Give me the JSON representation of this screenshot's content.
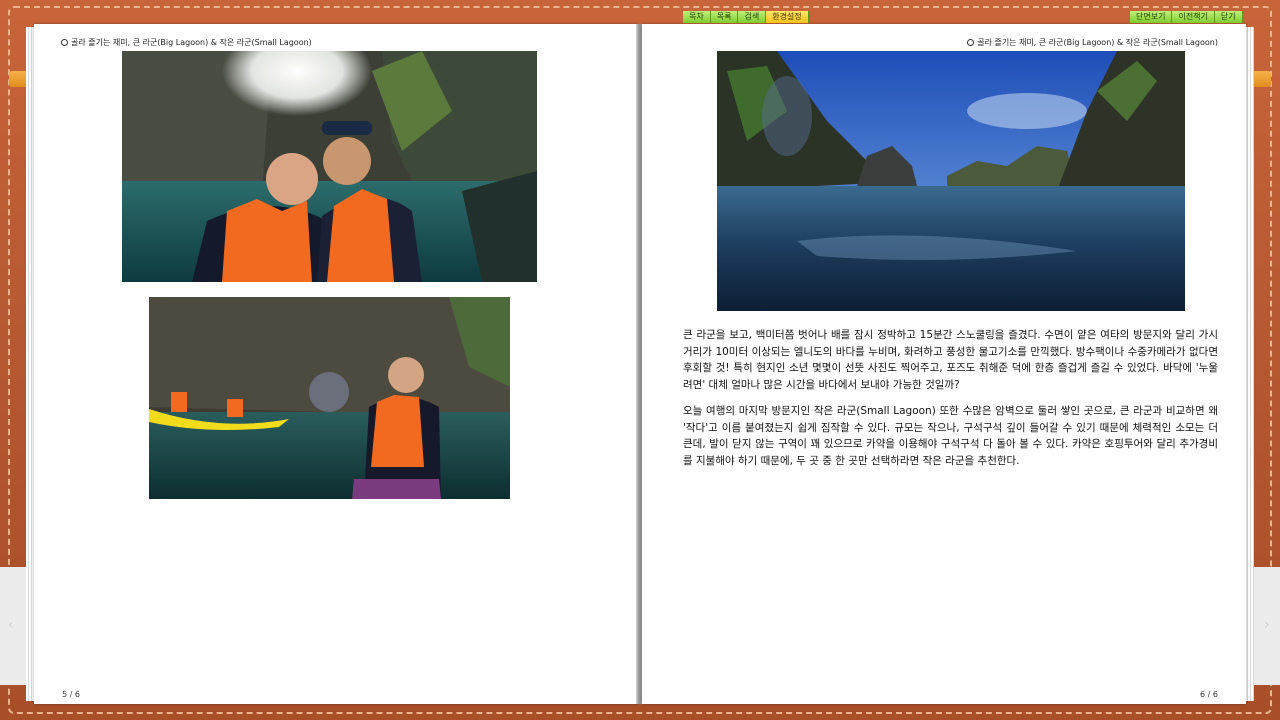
{
  "toolbar_left": [
    "목차",
    "목록",
    "검색",
    "환경설정"
  ],
  "toolbar_right": [
    "단면보기",
    "이전책기",
    "닫기"
  ],
  "left_page": {
    "header": "골라 즐기는 재미, 큰 라군(Big Lagoon) & 작은 라군(Small Lagoon)",
    "page_number": "5 / 6"
  },
  "right_page": {
    "header": "골라 즐기는 재미, 큰 라군(Big Lagoon) & 작은 라군(Small Lagoon)",
    "page_number": "6 / 6",
    "paragraphs": [
      "큰 라군을 보고, 백미터쯤 벗어나 배를 잠시 정박하고 15분간 스노쿨링을 즐겼다. 수면이 얕은 여타의 방문지와 달리 가시거리가 10미터 이상되는 엘니도의 바다를 누비며, 화려하고 풍성한 물고기소를 만끽했다. 방수팩이나 수중카메라가 없다면 후회할 것! 특히 현지인 소년 몇몇이 선뜻 사진도 찍어주고, 포즈도 취해준 덕에 한층 즐겁게 즐길 수 있었다. 바닥에 '누울려면' 대체 얼마나 많은 시간을 바다에서 보내야 가능한 것일까?",
      "오늘 여행의 마지막 방문지인 작은 라군(Small Lagoon) 또한 수많은 암벽으로 둘러 쌓인 곳으로, 큰 라군과 비교하면 왜 '작다'고 이름 붙여졌는지 쉽게 짐작할 수 있다. 규모는 작으나, 구석구석 깊이 들어갈 수 있기 때문에 체력적인 소모는 더 큰데, 발이 닫지 않는 구역이 꽤 있으므로 카약을 이용해야 구석구석 다 돌아 볼 수 있다. 카약은 호핑투어와 달리 추가경비를 지불해야 하기 때문에, 두 곳 중 한 곳만 선택하라면 작은 라군을 추천한다."
    ]
  }
}
